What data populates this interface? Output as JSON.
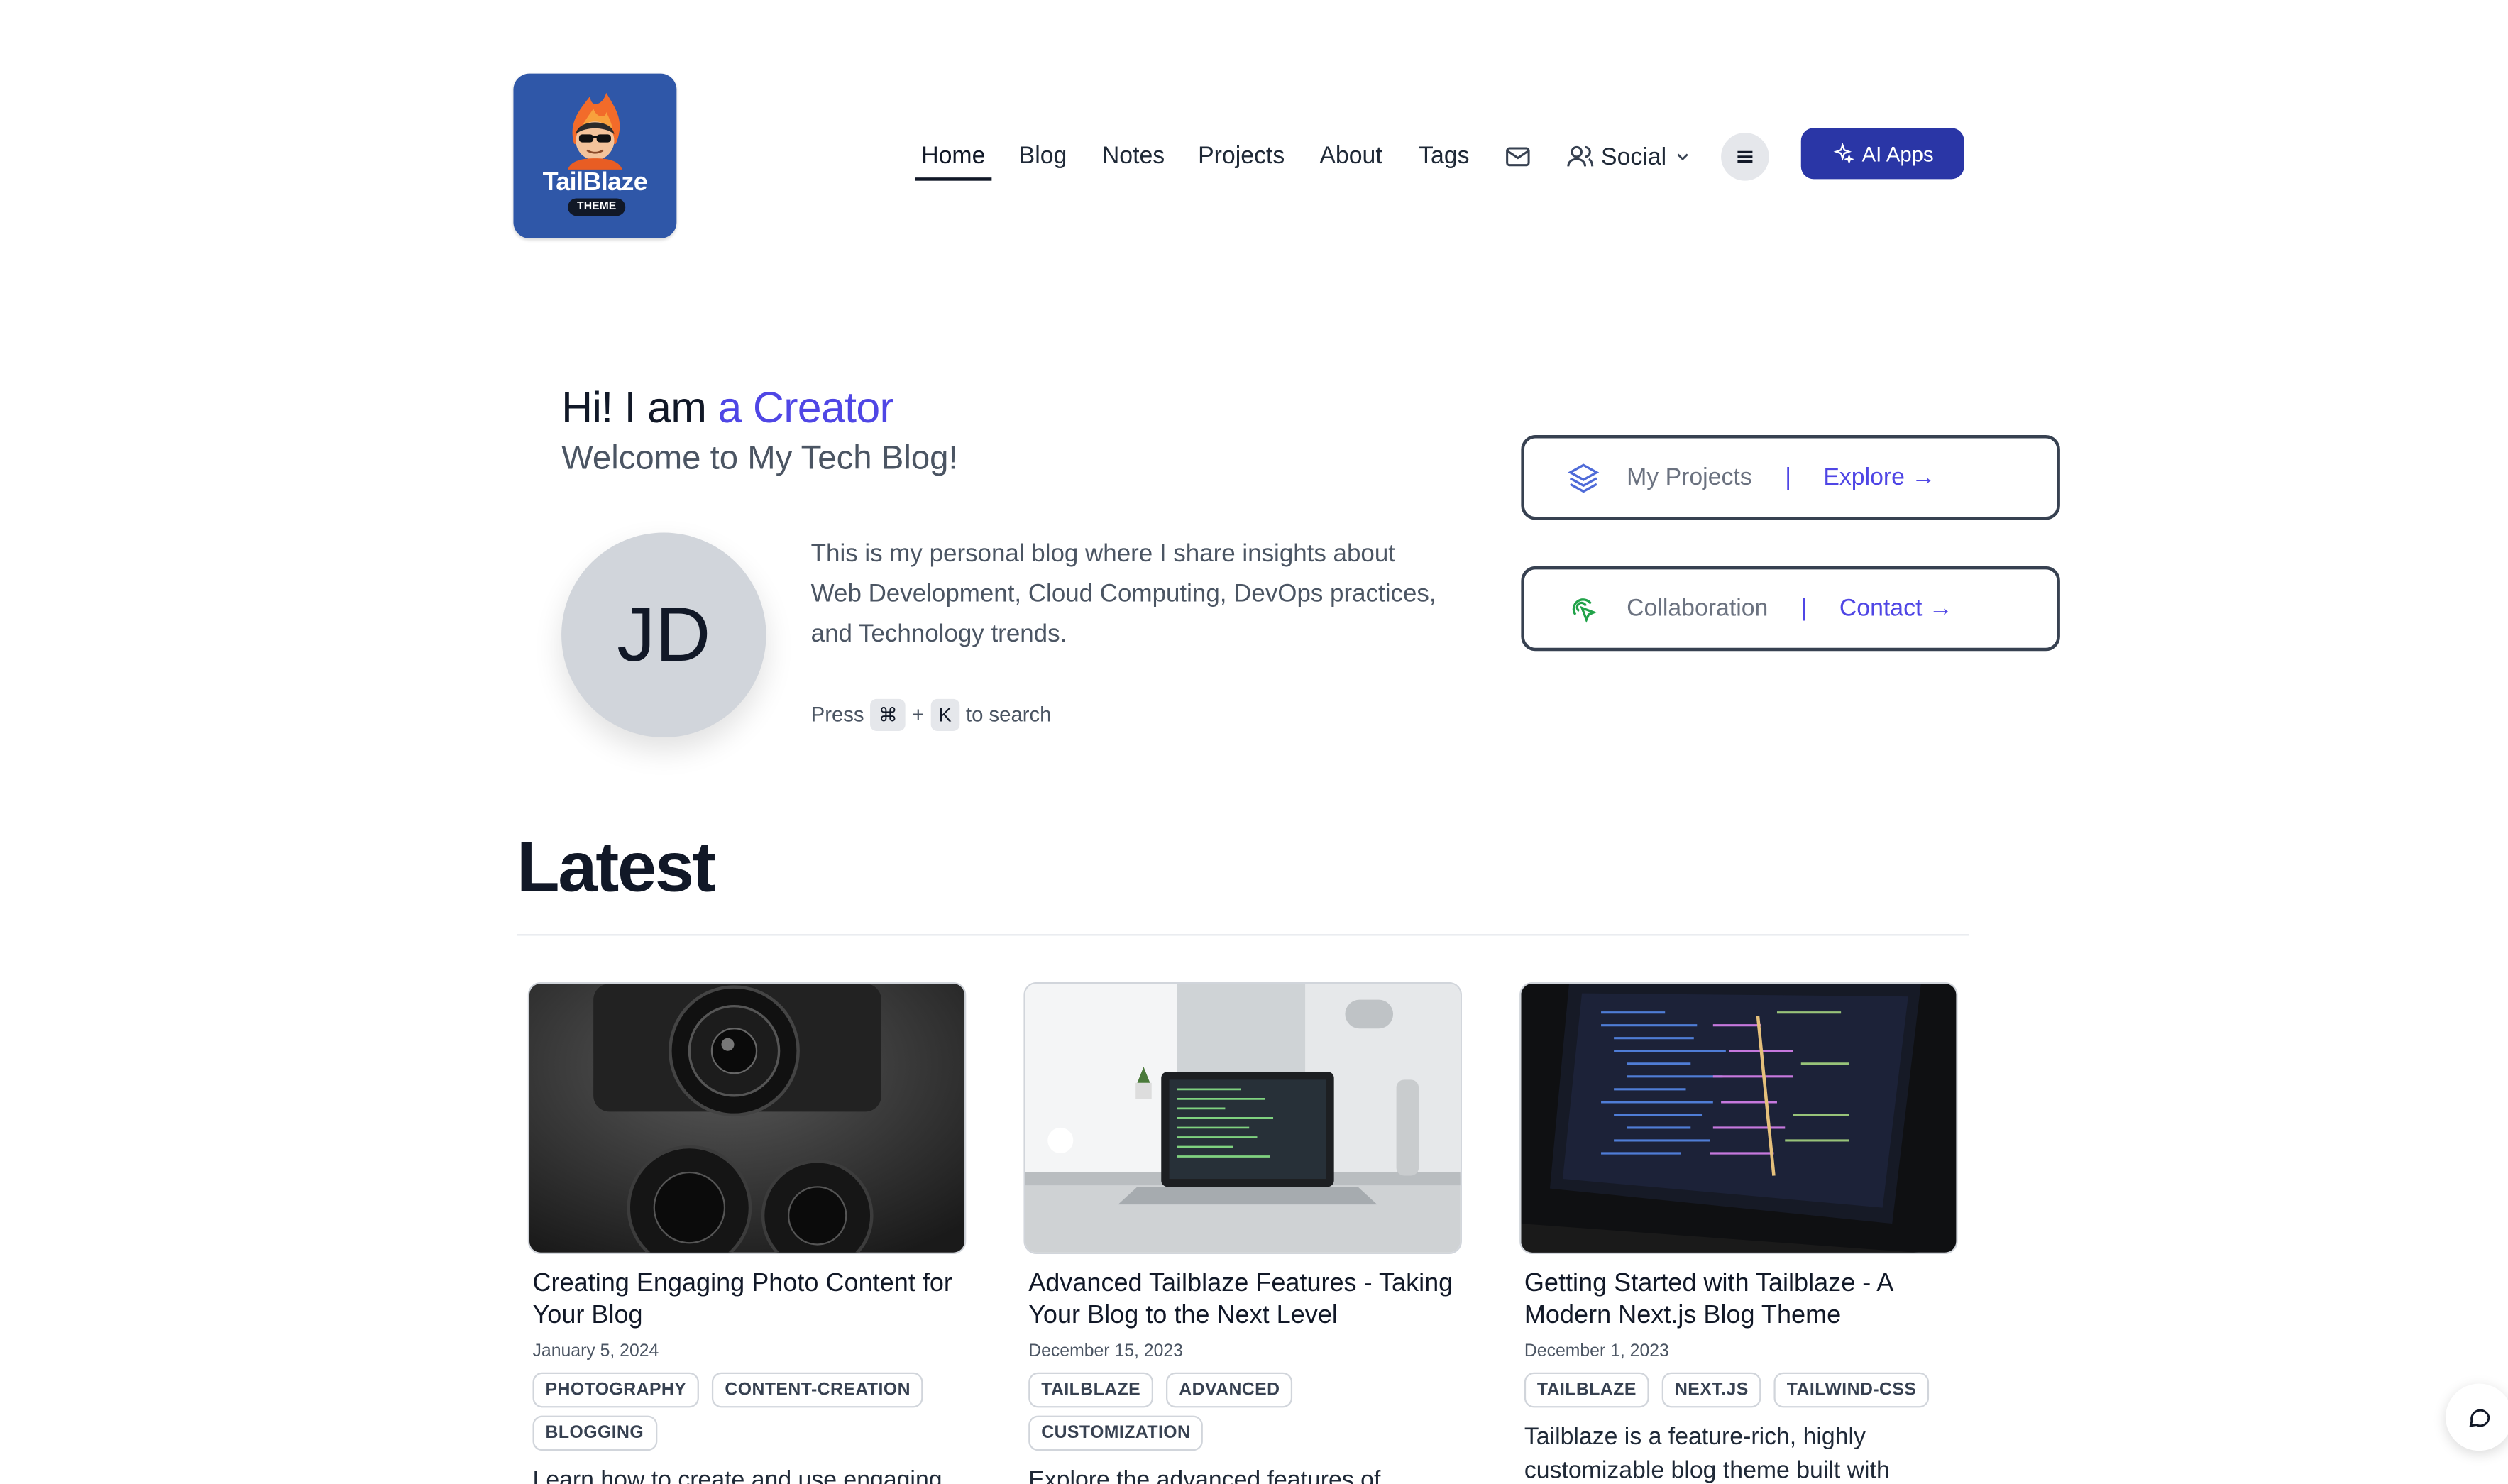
{
  "brand": {
    "name": "TailBlaze",
    "badge": "THEME"
  },
  "nav": {
    "items": [
      {
        "label": "Home",
        "active": true
      },
      {
        "label": "Blog",
        "active": false
      },
      {
        "label": "Notes",
        "active": false
      },
      {
        "label": "Projects",
        "active": false
      },
      {
        "label": "About",
        "active": false
      },
      {
        "label": "Tags",
        "active": false
      }
    ],
    "social_label": "Social",
    "ai_button": "AI Apps",
    "icons": [
      "mail-icon",
      "users-icon",
      "chevron-down-icon",
      "menu-icon",
      "sparkles-icon"
    ]
  },
  "hero": {
    "greeting": "Hi! I am ",
    "role": "a Creator",
    "subtitle": "Welcome to My Tech Blog!",
    "avatar_initials": "JD",
    "bio": "This is my personal blog where I share insights about Web Development, Cloud Computing, DevOps practices, and Technology trends.",
    "search_hint": {
      "press": "Press",
      "key1": "⌘",
      "plus": "+",
      "key2": "K",
      "suffix": "to search"
    }
  },
  "quick_links": [
    {
      "label": "My Projects",
      "separator": "|",
      "action": "Explore →",
      "icon": "layers-icon"
    },
    {
      "label": "Collaboration",
      "separator": "|",
      "action": "Contact →",
      "icon": "pointer-click-icon"
    }
  ],
  "latest": {
    "heading": "Latest",
    "posts": [
      {
        "title": "Creating Engaging Photo Content for Your Blog",
        "date": "January 5, 2024",
        "tags": [
          "PHOTOGRAPHY",
          "CONTENT-CREATION",
          "BLOGGING"
        ],
        "excerpt": "Learn how to create and use engaging"
      },
      {
        "title": "Advanced Tailblaze Features - Taking Your Blog to the Next Level",
        "date": "December 15, 2023",
        "tags": [
          "TAILBLAZE",
          "ADVANCED",
          "CUSTOMIZATION"
        ],
        "excerpt": "Explore the advanced features of"
      },
      {
        "title": "Getting Started with Tailblaze - A Modern Next.js Blog Theme",
        "date": "December 1, 2023",
        "tags": [
          "TAILBLAZE",
          "NEXT.JS",
          "TAILWIND-CSS"
        ],
        "excerpt": "Tailblaze is a feature-rich, highly customizable blog theme built with"
      }
    ]
  },
  "colors": {
    "accent": "#4f46e5",
    "ai_button": "#2a36a6",
    "logo_bg": "#2f57a8"
  }
}
